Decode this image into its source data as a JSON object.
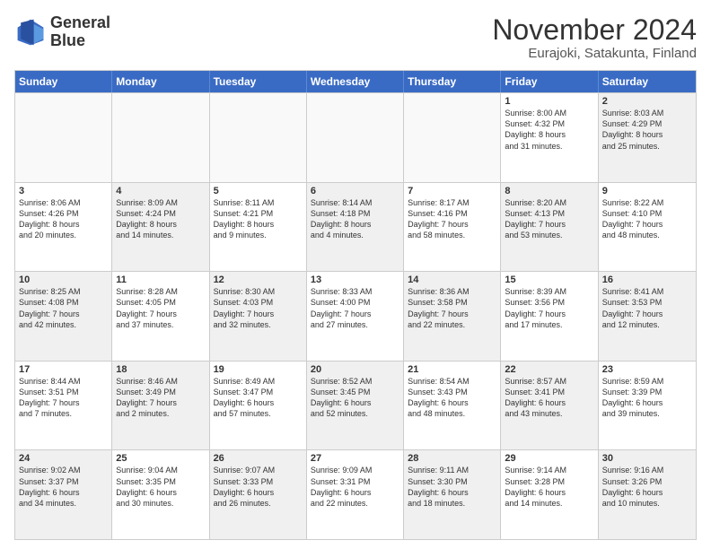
{
  "logo": {
    "line1": "General",
    "line2": "Blue"
  },
  "title": "November 2024",
  "subtitle": "Eurajoki, Satakunta, Finland",
  "header": {
    "days": [
      "Sunday",
      "Monday",
      "Tuesday",
      "Wednesday",
      "Thursday",
      "Friday",
      "Saturday"
    ]
  },
  "rows": [
    [
      {
        "day": "",
        "empty": true
      },
      {
        "day": "",
        "empty": true
      },
      {
        "day": "",
        "empty": true
      },
      {
        "day": "",
        "empty": true
      },
      {
        "day": "",
        "empty": true
      },
      {
        "day": "1",
        "info": "Sunrise: 8:00 AM\nSunset: 4:32 PM\nDaylight: 8 hours\nand 31 minutes."
      },
      {
        "day": "2",
        "info": "Sunrise: 8:03 AM\nSunset: 4:29 PM\nDaylight: 8 hours\nand 25 minutes.",
        "shaded": true
      }
    ],
    [
      {
        "day": "3",
        "info": "Sunrise: 8:06 AM\nSunset: 4:26 PM\nDaylight: 8 hours\nand 20 minutes."
      },
      {
        "day": "4",
        "info": "Sunrise: 8:09 AM\nSunset: 4:24 PM\nDaylight: 8 hours\nand 14 minutes.",
        "shaded": true
      },
      {
        "day": "5",
        "info": "Sunrise: 8:11 AM\nSunset: 4:21 PM\nDaylight: 8 hours\nand 9 minutes."
      },
      {
        "day": "6",
        "info": "Sunrise: 8:14 AM\nSunset: 4:18 PM\nDaylight: 8 hours\nand 4 minutes.",
        "shaded": true
      },
      {
        "day": "7",
        "info": "Sunrise: 8:17 AM\nSunset: 4:16 PM\nDaylight: 7 hours\nand 58 minutes."
      },
      {
        "day": "8",
        "info": "Sunrise: 8:20 AM\nSunset: 4:13 PM\nDaylight: 7 hours\nand 53 minutes.",
        "shaded": true
      },
      {
        "day": "9",
        "info": "Sunrise: 8:22 AM\nSunset: 4:10 PM\nDaylight: 7 hours\nand 48 minutes."
      }
    ],
    [
      {
        "day": "10",
        "info": "Sunrise: 8:25 AM\nSunset: 4:08 PM\nDaylight: 7 hours\nand 42 minutes.",
        "shaded": true
      },
      {
        "day": "11",
        "info": "Sunrise: 8:28 AM\nSunset: 4:05 PM\nDaylight: 7 hours\nand 37 minutes."
      },
      {
        "day": "12",
        "info": "Sunrise: 8:30 AM\nSunset: 4:03 PM\nDaylight: 7 hours\nand 32 minutes.",
        "shaded": true
      },
      {
        "day": "13",
        "info": "Sunrise: 8:33 AM\nSunset: 4:00 PM\nDaylight: 7 hours\nand 27 minutes."
      },
      {
        "day": "14",
        "info": "Sunrise: 8:36 AM\nSunset: 3:58 PM\nDaylight: 7 hours\nand 22 minutes.",
        "shaded": true
      },
      {
        "day": "15",
        "info": "Sunrise: 8:39 AM\nSunset: 3:56 PM\nDaylight: 7 hours\nand 17 minutes."
      },
      {
        "day": "16",
        "info": "Sunrise: 8:41 AM\nSunset: 3:53 PM\nDaylight: 7 hours\nand 12 minutes.",
        "shaded": true
      }
    ],
    [
      {
        "day": "17",
        "info": "Sunrise: 8:44 AM\nSunset: 3:51 PM\nDaylight: 7 hours\nand 7 minutes."
      },
      {
        "day": "18",
        "info": "Sunrise: 8:46 AM\nSunset: 3:49 PM\nDaylight: 7 hours\nand 2 minutes.",
        "shaded": true
      },
      {
        "day": "19",
        "info": "Sunrise: 8:49 AM\nSunset: 3:47 PM\nDaylight: 6 hours\nand 57 minutes."
      },
      {
        "day": "20",
        "info": "Sunrise: 8:52 AM\nSunset: 3:45 PM\nDaylight: 6 hours\nand 52 minutes.",
        "shaded": true
      },
      {
        "day": "21",
        "info": "Sunrise: 8:54 AM\nSunset: 3:43 PM\nDaylight: 6 hours\nand 48 minutes."
      },
      {
        "day": "22",
        "info": "Sunrise: 8:57 AM\nSunset: 3:41 PM\nDaylight: 6 hours\nand 43 minutes.",
        "shaded": true
      },
      {
        "day": "23",
        "info": "Sunrise: 8:59 AM\nSunset: 3:39 PM\nDaylight: 6 hours\nand 39 minutes."
      }
    ],
    [
      {
        "day": "24",
        "info": "Sunrise: 9:02 AM\nSunset: 3:37 PM\nDaylight: 6 hours\nand 34 minutes.",
        "shaded": true
      },
      {
        "day": "25",
        "info": "Sunrise: 9:04 AM\nSunset: 3:35 PM\nDaylight: 6 hours\nand 30 minutes."
      },
      {
        "day": "26",
        "info": "Sunrise: 9:07 AM\nSunset: 3:33 PM\nDaylight: 6 hours\nand 26 minutes.",
        "shaded": true
      },
      {
        "day": "27",
        "info": "Sunrise: 9:09 AM\nSunset: 3:31 PM\nDaylight: 6 hours\nand 22 minutes."
      },
      {
        "day": "28",
        "info": "Sunrise: 9:11 AM\nSunset: 3:30 PM\nDaylight: 6 hours\nand 18 minutes.",
        "shaded": true
      },
      {
        "day": "29",
        "info": "Sunrise: 9:14 AM\nSunset: 3:28 PM\nDaylight: 6 hours\nand 14 minutes."
      },
      {
        "day": "30",
        "info": "Sunrise: 9:16 AM\nSunset: 3:26 PM\nDaylight: 6 hours\nand 10 minutes.",
        "shaded": true
      }
    ]
  ]
}
